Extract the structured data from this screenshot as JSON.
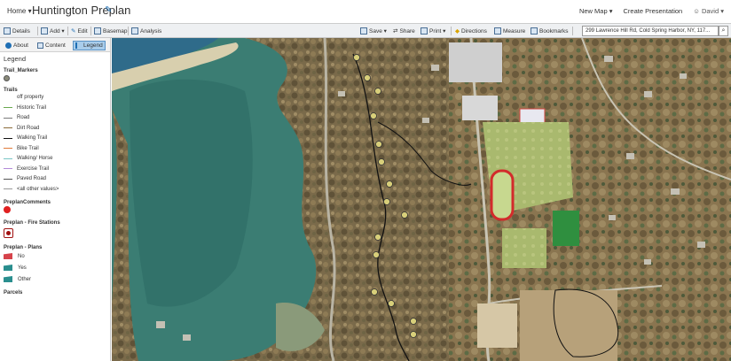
{
  "header": {
    "home_label": "Home ▾",
    "title": "Huntington Preplan",
    "new_map": "New Map ▾",
    "create_presentation": "Create Presentation",
    "user": "David ▾"
  },
  "toolbar": {
    "details": "Details",
    "add": "Add ▾",
    "edit": "Edit",
    "basemap": "Basemap",
    "analysis": "Analysis",
    "save": "Save ▾",
    "share": "Share",
    "print": "Print ▾",
    "directions": "Directions",
    "measure": "Measure",
    "bookmarks": "Bookmarks",
    "search_value": "299 Lawrence Hill Rd, Cold Spring Harbor, NY, 117..."
  },
  "panel": {
    "tabs": {
      "about": "About",
      "content": "Content",
      "legend": "Legend"
    },
    "legend_title": "Legend",
    "groups": {
      "trail_markers": "Trail_Markers",
      "trails": "Trails",
      "preplan_comments": "PreplanComments",
      "fire_stations": "Preplan - Fire Stations",
      "plans": "Preplan - Plans",
      "parcels": "Parcels"
    },
    "trails": [
      {
        "label": "off property",
        "color": "#ffffff"
      },
      {
        "label": "Historic Trail",
        "color": "#6aa84f"
      },
      {
        "label": "Road",
        "color": "#7a7a7a"
      },
      {
        "label": "Dirt Road",
        "color": "#8b6b3a"
      },
      {
        "label": "Walking Trail",
        "color": "#111111"
      },
      {
        "label": "Bike Trail",
        "color": "#e07a3a"
      },
      {
        "label": "Walking/ Horse",
        "color": "#79c6c6"
      },
      {
        "label": "Exercise Trail",
        "color": "#b38ad8"
      },
      {
        "label": "Paved Road",
        "color": "#555555"
      },
      {
        "label": "<all other values>",
        "color": "#999999"
      }
    ],
    "plans": [
      {
        "label": "No",
        "color": "#d6434b"
      },
      {
        "label": "Yes",
        "color": "#2a8e8e"
      },
      {
        "label": "Other",
        "color": "#2a8e8e"
      }
    ]
  },
  "colors": {
    "accent": "#1f6fb4",
    "active_tab": "#a9cdeb",
    "water": "#3b7d73",
    "track": "#d22b2b"
  }
}
